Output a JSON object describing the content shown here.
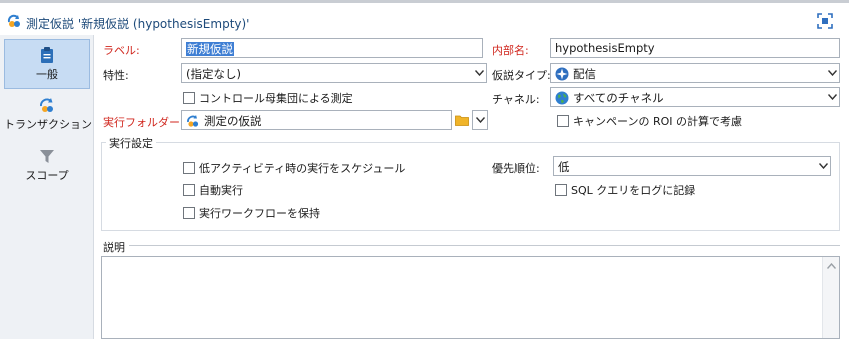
{
  "window": {
    "title": "測定仮説 '新規仮説 (hypothesisEmpty)'"
  },
  "sidebar": {
    "items": [
      {
        "label": "一般",
        "icon": "clipboard-icon",
        "active": true
      },
      {
        "label": "トランザクション",
        "icon": "transaction-icon",
        "active": false
      },
      {
        "label": "スコープ",
        "icon": "filter-icon",
        "active": false
      }
    ]
  },
  "form": {
    "label": {
      "caption": "ラベル:",
      "value": "新規仮説"
    },
    "internal_name": {
      "caption": "内部名:",
      "value": "hypothesisEmpty"
    },
    "characteristic": {
      "caption": "特性:",
      "value": "(指定なし)"
    },
    "hypothesis_type": {
      "caption": "仮説タイプ:",
      "value": "配信"
    },
    "control_group": {
      "label": "コントロール母集団による測定",
      "checked": false
    },
    "channel": {
      "caption": "チャネル:",
      "value": "すべてのチャネル"
    },
    "execution_folder": {
      "caption": "実行フォルダー:",
      "value": "測定の仮説"
    },
    "campaign_roi": {
      "label": "キャンペーンの ROI の計算で考慮",
      "checked": false
    }
  },
  "execution_settings": {
    "title": "実行設定",
    "schedule_low_activity": {
      "label": "低アクティビティ時の実行をスケジュール",
      "checked": false
    },
    "auto_run": {
      "label": "自動実行",
      "checked": false
    },
    "keep_workflow": {
      "label": "実行ワークフローを保持",
      "checked": false
    },
    "priority": {
      "caption": "優先順位:",
      "value": "低"
    },
    "log_sql": {
      "label": "SQL クエリをログに記録",
      "checked": false
    }
  },
  "description": {
    "title": "説明",
    "value": ""
  },
  "colors": {
    "accent": "#3f7fd4",
    "required_label": "#d0261d",
    "sidebar_bg": "#eef1f5",
    "sidebar_active": "#c7dcf3"
  }
}
